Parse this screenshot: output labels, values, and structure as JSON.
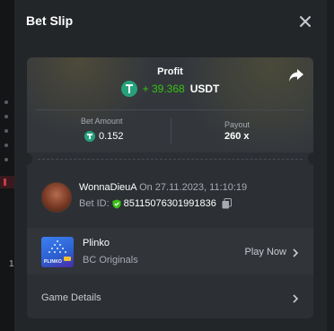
{
  "backdrop": {
    "partial_number": "1"
  },
  "header": {
    "title": "Bet Slip"
  },
  "profit": {
    "label": "Profit",
    "value": "+ 39.368",
    "currency": "USDT"
  },
  "stats": {
    "bet_amount_label": "Bet Amount",
    "bet_amount_value": "0.152",
    "payout_label": "Payout",
    "payout_value": "260 x"
  },
  "user": {
    "name": "WonnaDieuA",
    "time": "On 27.11.2023, 11:10:19",
    "bet_id_label": "Bet ID:",
    "bet_id_value": "85115076301991836"
  },
  "game": {
    "thumb_label": "PLINKO",
    "name": "Plinko",
    "provider": "BC Originals",
    "play_label": "Play Now"
  },
  "game_details": {
    "label": "Game Details"
  },
  "colors": {
    "profit_green": "#3bc117",
    "usdt_green": "#26a17b",
    "verified_green": "#3bc117",
    "panel_bg": "#232629"
  },
  "icons": {
    "close": "close-icon",
    "share": "share-arrow-icon",
    "coin": "usdt-coin-icon",
    "verified": "shield-check-icon",
    "copy": "copy-icon",
    "chevron": "chevron-right-icon"
  }
}
